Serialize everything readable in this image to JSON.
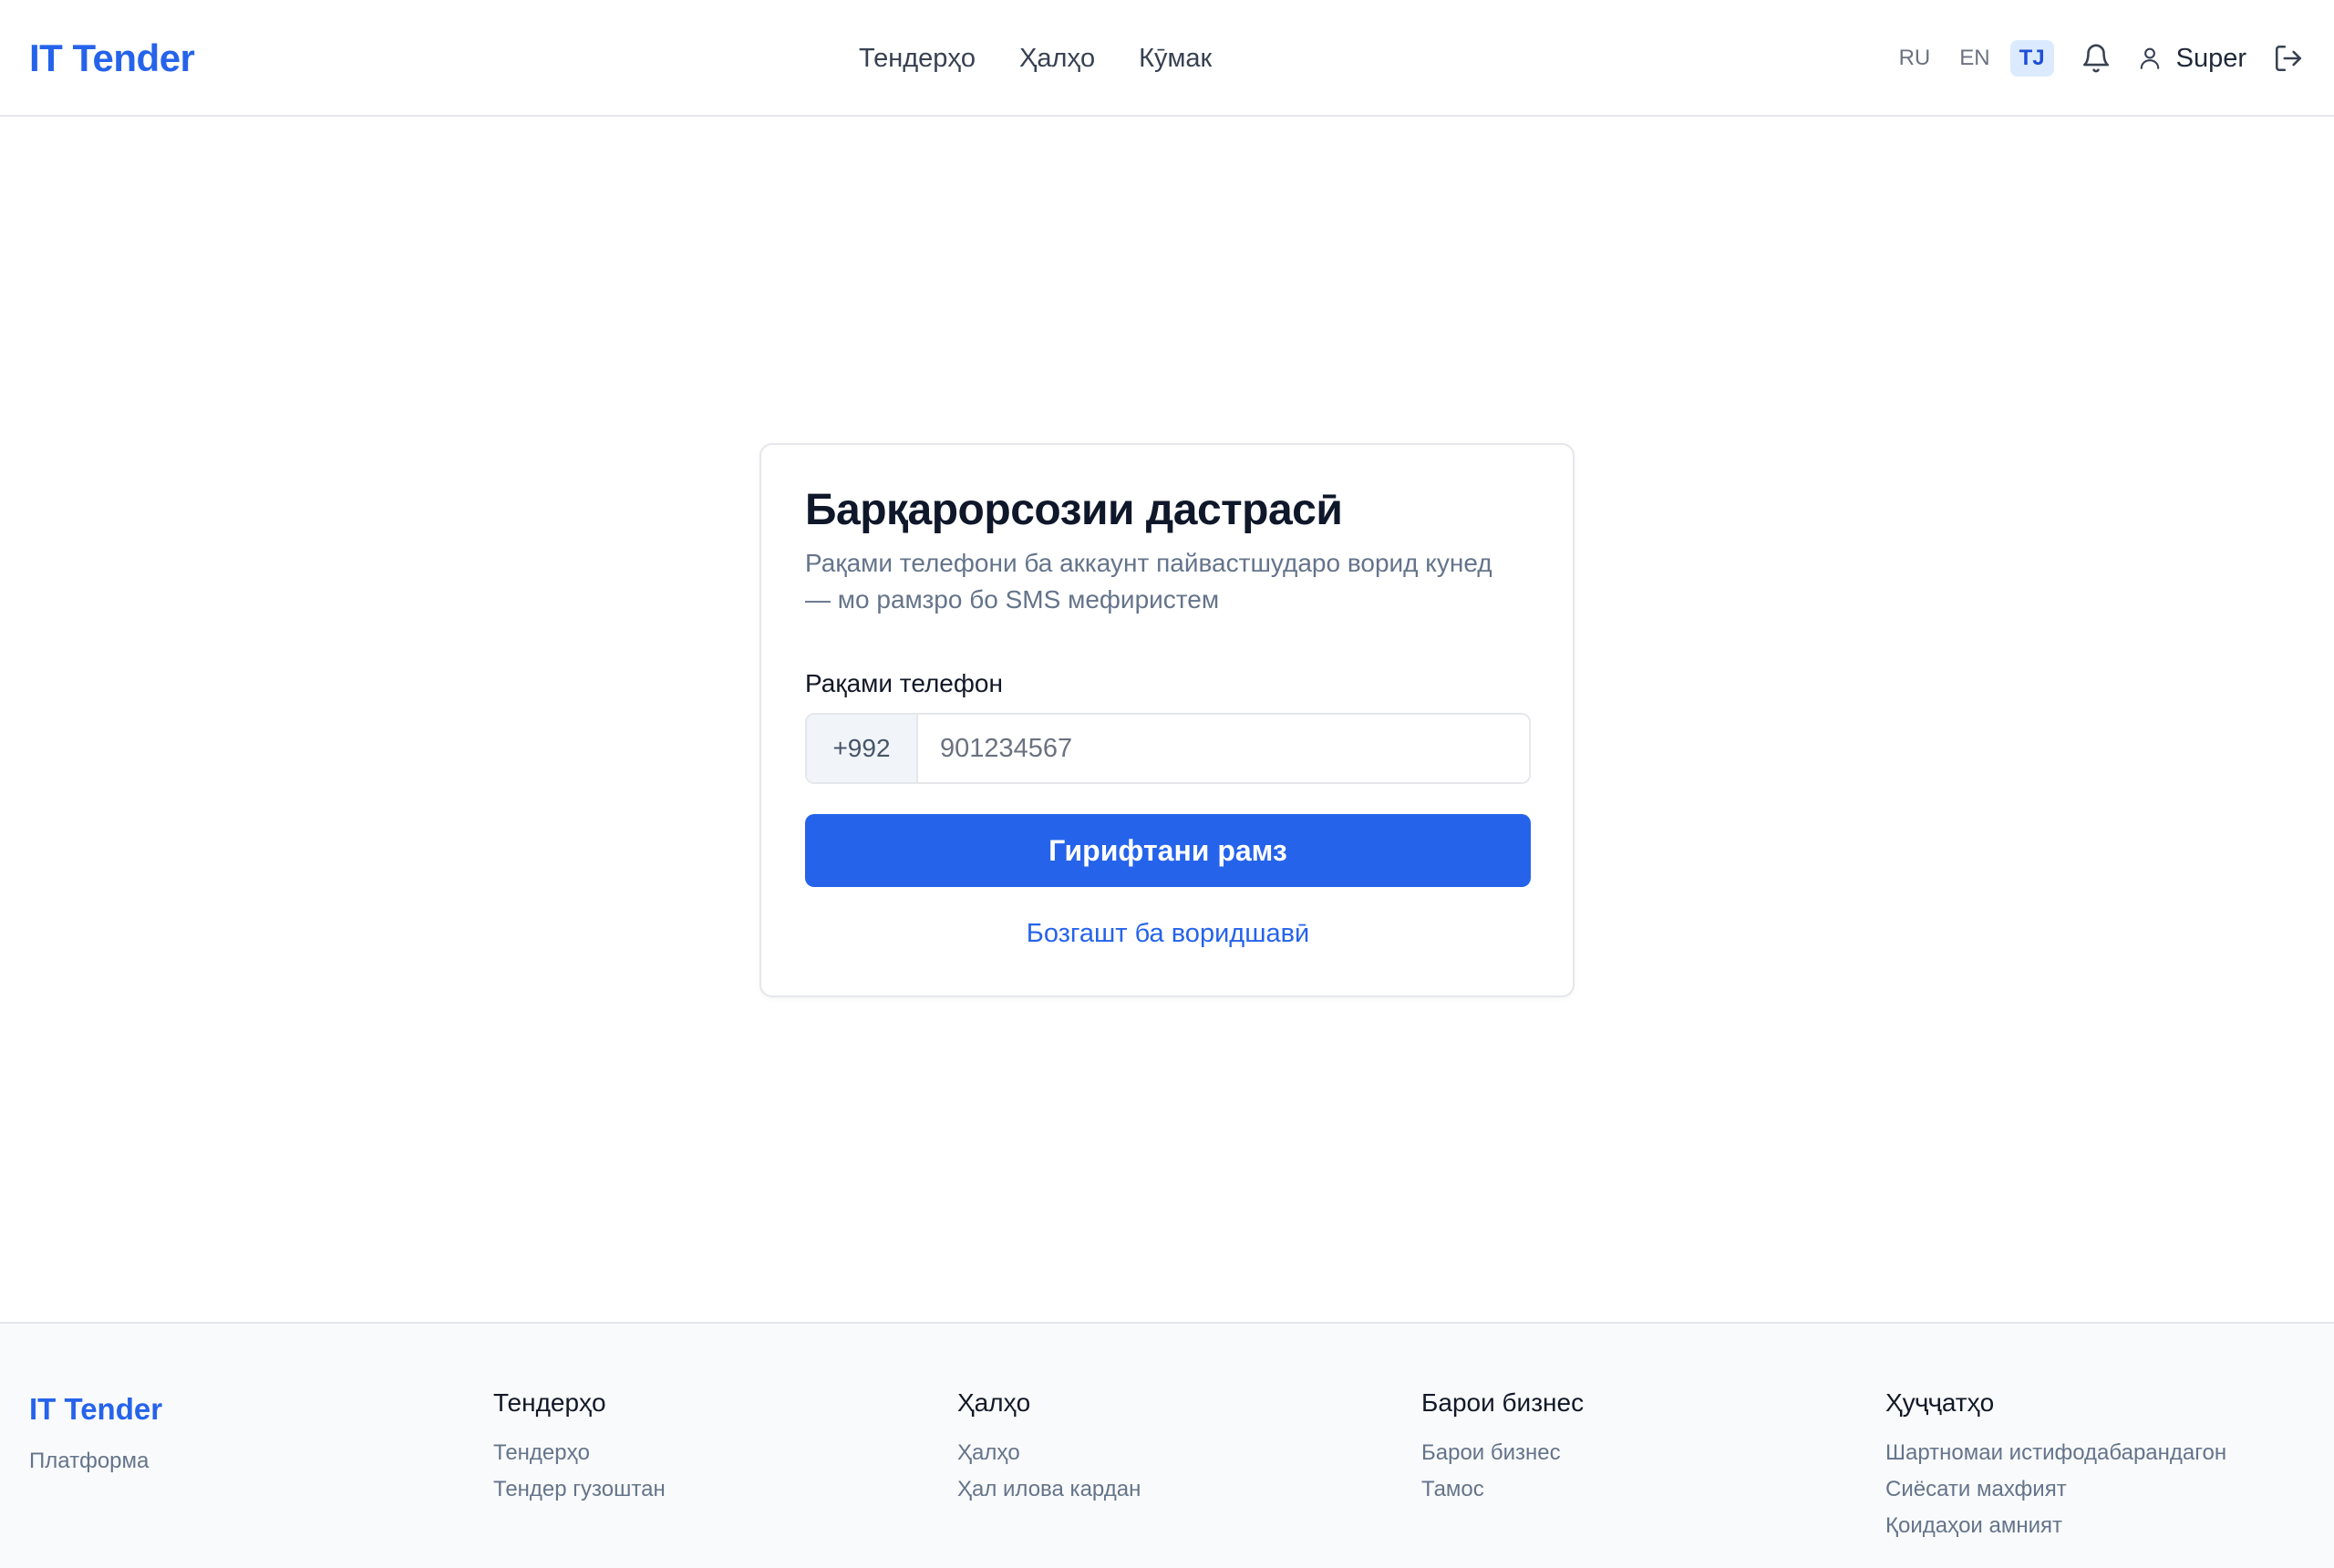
{
  "header": {
    "logo": "IT Tender",
    "nav": [
      "Тендерҳо",
      "Ҳалҳо",
      "Кӯмак"
    ],
    "languages": [
      "RU",
      "EN",
      "TJ"
    ],
    "active_language": "TJ",
    "user_name": "Super",
    "icons": {
      "notifications": "bell-icon",
      "user": "user-icon",
      "logout": "logout-icon"
    }
  },
  "card": {
    "title": "Барқарорсозии дастрасӣ",
    "subtitle": "Рақами телефони ба аккаунт пайвастшударо ворид кунед — мо рамзро бо SMS мефиристем",
    "phone_label": "Рақами телефон",
    "phone_prefix": "+992",
    "phone_placeholder": "901234567",
    "phone_value": "",
    "submit_label": "Гирифтани рамз",
    "back_link": "Бозгашт ба воридшавӣ"
  },
  "footer": {
    "logo": "IT Tender",
    "tagline": "Платформа",
    "columns": [
      {
        "title": "Тендерҳо",
        "links": [
          "Тендерҳо",
          "Тендер гузоштан"
        ]
      },
      {
        "title": "Ҳалҳо",
        "links": [
          "Ҳалҳо",
          "Ҳал илова кардан"
        ]
      },
      {
        "title": "Барои бизнес",
        "links": [
          "Барои бизнес",
          "Тамос"
        ]
      },
      {
        "title": "Ҳуҷҷатҳо",
        "links": [
          "Шартномаи истифодабарандагон",
          "Сиёсати махфият",
          "Қоидаҳои амният"
        ]
      }
    ]
  },
  "colors": {
    "accent": "#2563eb",
    "accent_light": "#dbeafe",
    "muted_text": "#64748b",
    "border": "#e5e7eb",
    "footer_bg": "#f9fafb"
  }
}
